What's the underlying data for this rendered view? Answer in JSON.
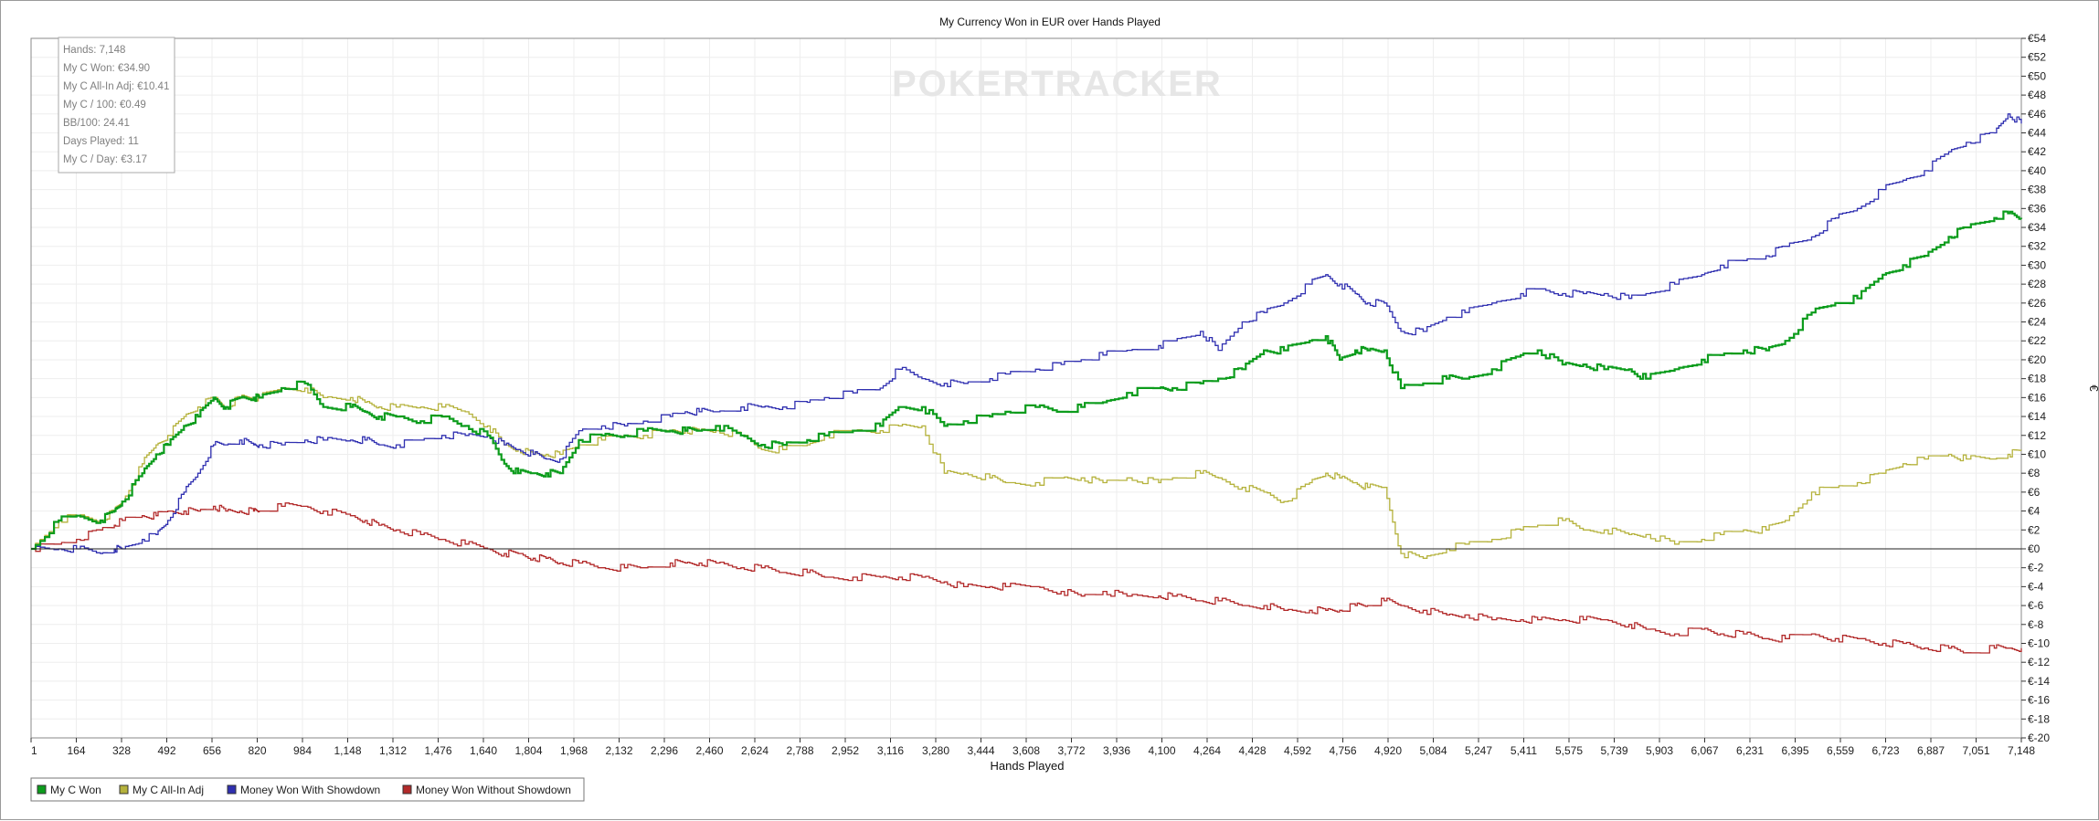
{
  "chart_data": {
    "type": "line",
    "title": "My Currency Won in EUR over Hands Played",
    "xlabel": "Hands Played",
    "ylabel": "€",
    "watermark": "POKERTRACKER",
    "xlim": [
      1,
      7148
    ],
    "ylim": [
      -20,
      54
    ],
    "x_ticks": [
      "1",
      "164",
      "328",
      "492",
      "656",
      "820",
      "984",
      "1,148",
      "1,312",
      "1,476",
      "1,640",
      "1,804",
      "1,968",
      "2,132",
      "2,296",
      "2,460",
      "2,624",
      "2,788",
      "2,952",
      "3,116",
      "3,280",
      "3,444",
      "3,608",
      "3,772",
      "3,936",
      "4,100",
      "4,264",
      "4,428",
      "4,592",
      "4,756",
      "4,920",
      "5,084",
      "5,247",
      "5,411",
      "5,575",
      "5,739",
      "5,903",
      "6,067",
      "6,231",
      "6,395",
      "6,559",
      "6,723",
      "6,887",
      "7,051",
      "7,148"
    ],
    "y_ticks": [
      "€54",
      "€52",
      "€50",
      "€48",
      "€46",
      "€44",
      "€42",
      "€40",
      "€38",
      "€36",
      "€34",
      "€32",
      "€30",
      "€28",
      "€26",
      "€24",
      "€22",
      "€20",
      "€18",
      "€16",
      "€14",
      "€12",
      "€10",
      "€8",
      "€6",
      "€4",
      "€2",
      "€0",
      "€-2",
      "€-4",
      "€-6",
      "€-8",
      "€-10",
      "€-12",
      "€-14",
      "€-16",
      "€-18",
      "€-20"
    ],
    "grid": true,
    "legend_position": "bottom-left",
    "stats_box": [
      "Hands: 7,148",
      "My C Won: €34.90",
      "My C All-In Adj: €10.41",
      "My C / 100: €0.49",
      "BB/100: 24.41",
      "Days Played: 11",
      "My C / Day: €3.17"
    ],
    "series": [
      {
        "name": "My C Won",
        "color": "#0c9c1c",
        "x": [
          1,
          100,
          164,
          250,
          300,
          328,
          400,
          450,
          492,
          550,
          600,
          656,
          700,
          750,
          800,
          820,
          900,
          984,
          1050,
          1148,
          1200,
          1250,
          1312,
          1400,
          1476,
          1560,
          1640,
          1700,
          1750,
          1804,
          1850,
          1900,
          1968,
          2050,
          2132,
          2200,
          2296,
          2350,
          2400,
          2460,
          2550,
          2624,
          2700,
          2788,
          2850,
          2952,
          3050,
          3116,
          3200,
          3280,
          3350,
          3444,
          3500,
          3608,
          3700,
          3772,
          3850,
          3936,
          4050,
          4100,
          4200,
          4264,
          4350,
          4428,
          4500,
          4592,
          4650,
          4700,
          4756,
          4800,
          4860,
          4920,
          5000,
          5084,
          5150,
          5247,
          5350,
          5411,
          5500,
          5575,
          5650,
          5739,
          5800,
          5903,
          6000,
          6067,
          6150,
          6231,
          6300,
          6395,
          6480,
          6559,
          6650,
          6723,
          6800,
          6887,
          6950,
          7051,
          7100,
          7148
        ],
        "y": [
          0,
          3,
          3.5,
          3,
          4,
          5,
          8,
          10,
          11,
          13,
          14,
          16,
          15,
          16,
          16,
          16,
          17,
          17.5,
          15,
          15,
          14.5,
          14,
          14,
          13.5,
          14,
          13,
          12,
          9,
          8,
          8,
          8,
          8,
          11.5,
          12,
          12,
          12.5,
          12.5,
          12.5,
          12.5,
          13,
          12,
          11,
          11,
          11.5,
          12,
          12.5,
          13,
          15,
          15,
          13,
          13.5,
          14,
          14.5,
          15,
          14.5,
          15,
          15.5,
          16.5,
          17,
          17,
          17.5,
          18,
          19,
          21,
          21,
          22,
          22.5,
          20,
          21,
          21,
          21,
          17,
          17.5,
          18,
          18,
          19,
          20.5,
          21,
          19.5,
          19.5,
          19,
          19,
          18,
          19,
          20,
          20.5,
          21,
          21,
          22,
          25,
          26,
          26.5,
          29,
          30,
          31,
          33,
          34,
          35,
          35.5,
          34.9
        ]
      },
      {
        "name": "My C All-In Adj",
        "color": "#b5b23c",
        "x": [
          1,
          100,
          164,
          250,
          300,
          328,
          400,
          450,
          492,
          550,
          600,
          656,
          700,
          750,
          800,
          820,
          900,
          984,
          1050,
          1148,
          1200,
          1250,
          1312,
          1400,
          1476,
          1560,
          1640,
          1700,
          1750,
          1804,
          1850,
          1900,
          1968,
          2050,
          2132,
          2200,
          2296,
          2350,
          2400,
          2460,
          2550,
          2624,
          2700,
          2788,
          2850,
          2952,
          3050,
          3116,
          3200,
          3280,
          3350,
          3444,
          3500,
          3608,
          3700,
          3772,
          3850,
          3936,
          4050,
          4100,
          4200,
          4264,
          4350,
          4428,
          4500,
          4592,
          4650,
          4700,
          4756,
          4800,
          4860,
          4920,
          5000,
          5084,
          5150,
          5247,
          5350,
          5411,
          5500,
          5575,
          5650,
          5739,
          5800,
          5903,
          6000,
          6067,
          6150,
          6231,
          6300,
          6395,
          6480,
          6559,
          6650,
          6723,
          6800,
          6887,
          6950,
          7051,
          7100,
          7148
        ],
        "y": [
          0,
          3,
          3.5,
          3,
          4,
          5,
          9,
          11,
          12,
          14,
          15,
          16,
          15,
          16,
          16,
          16,
          17,
          17,
          16,
          16,
          15.5,
          15,
          15,
          15,
          15,
          14.5,
          13,
          11,
          10.5,
          10,
          10,
          10,
          11,
          11.5,
          12,
          12,
          12.5,
          12.5,
          12.5,
          12.5,
          12,
          10.5,
          10.5,
          11,
          12,
          12.5,
          12.5,
          13,
          13,
          8,
          8,
          7.5,
          7,
          7,
          7.5,
          7.5,
          7,
          7.5,
          7,
          7.5,
          8,
          7.5,
          6.5,
          6,
          5,
          7,
          8,
          7.5,
          7,
          6.5,
          6.5,
          -0.5,
          -1,
          0,
          0.5,
          1,
          2,
          2.5,
          3,
          2,
          2,
          1.5,
          1.5,
          0.5,
          1,
          1.5,
          2,
          2,
          3,
          6,
          6.5,
          7,
          8,
          9,
          9.5,
          10,
          9.5,
          9.5,
          10,
          10.4
        ]
      },
      {
        "name": "Money Won With Showdown",
        "color": "#2f2fb0",
        "x": [
          1,
          100,
          164,
          250,
          300,
          328,
          400,
          450,
          492,
          550,
          600,
          656,
          700,
          750,
          800,
          820,
          900,
          984,
          1050,
          1148,
          1200,
          1250,
          1312,
          1400,
          1476,
          1560,
          1640,
          1700,
          1750,
          1804,
          1850,
          1900,
          1968,
          2050,
          2132,
          2200,
          2296,
          2350,
          2400,
          2460,
          2550,
          2624,
          2700,
          2788,
          2850,
          2952,
          3050,
          3116,
          3200,
          3280,
          3350,
          3444,
          3500,
          3608,
          3700,
          3772,
          3850,
          3936,
          4050,
          4100,
          4200,
          4264,
          4350,
          4428,
          4500,
          4592,
          4650,
          4700,
          4756,
          4800,
          4860,
          4920,
          5000,
          5084,
          5150,
          5247,
          5350,
          5411,
          5500,
          5575,
          5650,
          5739,
          5800,
          5903,
          6000,
          6067,
          6150,
          6231,
          6300,
          6395,
          6480,
          6559,
          6650,
          6723,
          6800,
          6887,
          6950,
          7051,
          7100,
          7148
        ],
        "y": [
          0,
          0,
          0,
          -0.5,
          0,
          0,
          1,
          1.5,
          3,
          6,
          8,
          11,
          11,
          11.5,
          11,
          11,
          11,
          11.5,
          11.5,
          11.5,
          11.5,
          11,
          11,
          11.5,
          12,
          12,
          12,
          11,
          10.5,
          10,
          9.5,
          9.5,
          12.5,
          13,
          13,
          13.5,
          14,
          14.5,
          14.5,
          14.5,
          15,
          15,
          15,
          15.5,
          16,
          16.5,
          17,
          19,
          18,
          17.5,
          17.5,
          18,
          18.5,
          19,
          19.5,
          20,
          20.5,
          21,
          21.5,
          22,
          23,
          21,
          24,
          25,
          26,
          28,
          29,
          28,
          27,
          26,
          26,
          23,
          23,
          24.5,
          25,
          26,
          27,
          27.5,
          27,
          27,
          27,
          26.5,
          27,
          28,
          29,
          30,
          30.5,
          31,
          32,
          33,
          35,
          36,
          38,
          39,
          40,
          42,
          43,
          44,
          46,
          45
        ]
      },
      {
        "name": "Money Won Without Showdown",
        "color": "#b22a2a",
        "x": [
          1,
          100,
          164,
          250,
          300,
          328,
          400,
          450,
          492,
          550,
          600,
          656,
          700,
          750,
          800,
          820,
          900,
          984,
          1050,
          1148,
          1200,
          1250,
          1312,
          1400,
          1476,
          1560,
          1640,
          1700,
          1750,
          1804,
          1850,
          1900,
          1968,
          2050,
          2132,
          2200,
          2296,
          2350,
          2400,
          2460,
          2550,
          2624,
          2700,
          2788,
          2850,
          2952,
          3050,
          3116,
          3200,
          3280,
          3350,
          3444,
          3500,
          3608,
          3700,
          3772,
          3850,
          3936,
          4050,
          4100,
          4200,
          4264,
          4350,
          4428,
          4500,
          4592,
          4650,
          4700,
          4756,
          4800,
          4860,
          4920,
          5000,
          5084,
          5150,
          5247,
          5350,
          5411,
          5500,
          5575,
          5650,
          5739,
          5800,
          5903,
          6000,
          6067,
          6150,
          6231,
          6300,
          6395,
          6480,
          6559,
          6650,
          6723,
          6800,
          6887,
          6950,
          7051,
          7100,
          7148
        ],
        "y": [
          0,
          0.5,
          1,
          2,
          2.5,
          3,
          3.5,
          3.5,
          4,
          4,
          4,
          4.5,
          4,
          4,
          4,
          4,
          4.5,
          4.5,
          4,
          3.5,
          3,
          2.5,
          2,
          1.5,
          1,
          0.5,
          0,
          -0.5,
          -0.5,
          -1,
          -1,
          -1.5,
          -1.5,
          -2,
          -2,
          -2,
          -1.5,
          -1.5,
          -1.5,
          -1.5,
          -2,
          -2,
          -2.5,
          -2.5,
          -3,
          -3,
          -3,
          -3,
          -3,
          -3.5,
          -4,
          -4,
          -4,
          -4,
          -4.5,
          -5,
          -4.5,
          -5,
          -5,
          -5,
          -5.5,
          -5.5,
          -6,
          -6,
          -6.5,
          -6.5,
          -6.5,
          -6.5,
          -6,
          -6,
          -5.5,
          -6,
          -6.5,
          -7,
          -7,
          -7.5,
          -7.5,
          -7.5,
          -7.5,
          -7.5,
          -7.5,
          -8,
          -8.5,
          -9,
          -8.5,
          -9,
          -9,
          -9.5,
          -9.5,
          -9,
          -9.5,
          -9.5,
          -10,
          -10,
          -10.5,
          -10.5,
          -11,
          -10.5,
          -10.5,
          -10.5
        ]
      }
    ]
  }
}
